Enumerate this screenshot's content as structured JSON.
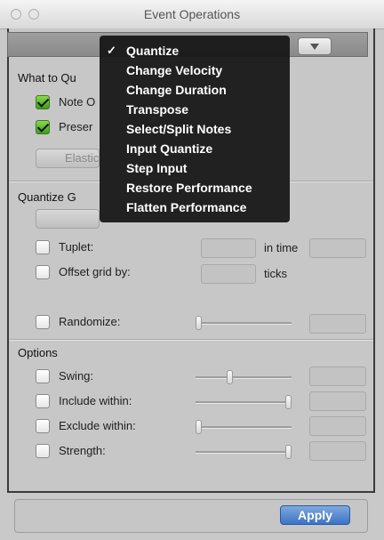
{
  "window": {
    "title": "Event Operations"
  },
  "what_to_quantize": {
    "heading": "What to Qu",
    "note_on_label": "Note O",
    "preserve_label": "Preser",
    "elastic_button": "Elastic"
  },
  "quantize_grid": {
    "heading": "Quantize G",
    "tuplet_label": "Tuplet:",
    "tuplet_in_time": "in time",
    "offset_label": "Offset grid by:",
    "offset_unit": "ticks",
    "randomize_label": "Randomize:"
  },
  "options": {
    "heading": "Options",
    "swing_label": "Swing:",
    "include_label": "Include within:",
    "exclude_label": "Exclude within:",
    "strength_label": "Strength:",
    "swing_level": 0.35,
    "include_level": 1.0,
    "exclude_level": 0.0,
    "strength_level": 1.0,
    "randomize_level": 0.0
  },
  "footer": {
    "apply_label": "Apply"
  },
  "menu": {
    "items": [
      {
        "label": "Quantize",
        "checked": "✓"
      },
      {
        "label": "Change Velocity"
      },
      {
        "label": "Change Duration"
      },
      {
        "label": "Transpose"
      },
      {
        "label": "Select/Split Notes"
      },
      {
        "label": "Input Quantize"
      },
      {
        "label": "Step Input"
      },
      {
        "label": "Restore Performance"
      },
      {
        "label": "Flatten Performance"
      }
    ]
  },
  "colors": {
    "accent": "#3b73c5",
    "checked": "#4aa624",
    "menu_bg": "#161616"
  }
}
